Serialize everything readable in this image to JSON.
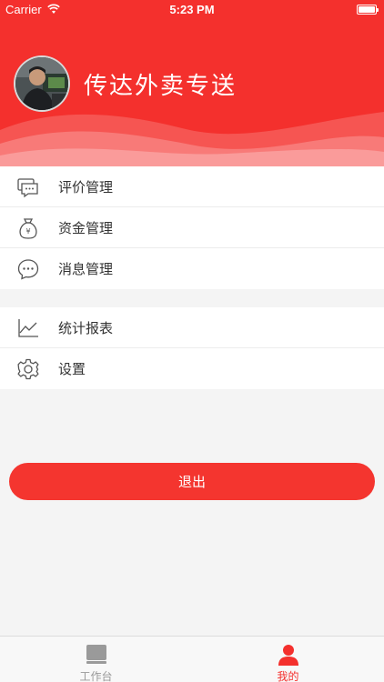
{
  "status_bar": {
    "carrier": "Carrier",
    "time": "5:23 PM"
  },
  "profile": {
    "shop_name": "传达外卖专送"
  },
  "menu": {
    "group1": [
      {
        "label": "评价管理",
        "icon": "chat-bubbles-icon"
      },
      {
        "label": "资金管理",
        "icon": "money-bag-icon"
      },
      {
        "label": "消息管理",
        "icon": "message-icon"
      }
    ],
    "group2": [
      {
        "label": "统计报表",
        "icon": "line-chart-icon"
      },
      {
        "label": "设置",
        "icon": "gear-icon"
      }
    ]
  },
  "logout_label": "退出",
  "tab_bar": {
    "tabs": [
      {
        "label": "工作台",
        "icon": "workbench-icon",
        "active": false
      },
      {
        "label": "我的",
        "icon": "person-icon",
        "active": true
      }
    ]
  },
  "colors": {
    "brand_red": "#f4302d",
    "inactive_gray": "#999999"
  }
}
